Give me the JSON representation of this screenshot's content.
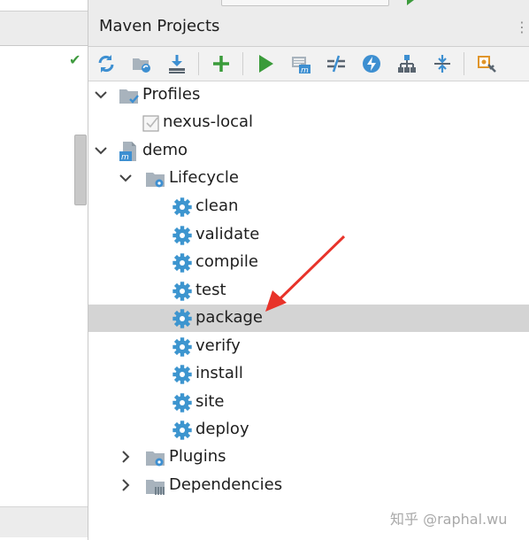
{
  "panel": {
    "title": "Maven Projects",
    "header_grip": "⋮"
  },
  "toolbar": {
    "buttons": [
      {
        "name": "reimport-icon"
      },
      {
        "name": "generate-sources-icon"
      },
      {
        "name": "download-icon"
      },
      {
        "name": "add-icon"
      },
      {
        "name": "run-icon"
      },
      {
        "name": "execute-goal-icon"
      },
      {
        "name": "toggle-offline-icon"
      },
      {
        "name": "skip-tests-icon"
      },
      {
        "name": "show-dependencies-icon"
      },
      {
        "name": "collapse-all-icon"
      },
      {
        "name": "settings-icon"
      }
    ]
  },
  "tree": {
    "profiles": {
      "label": "Profiles",
      "expanded": true,
      "children": [
        {
          "label": "nexus-local",
          "checked": false
        }
      ]
    },
    "project": {
      "label": "demo",
      "expanded": true
    },
    "lifecycle": {
      "label": "Lifecycle",
      "expanded": true,
      "goals": [
        "clean",
        "validate",
        "compile",
        "test",
        "package",
        "verify",
        "install",
        "site",
        "deploy"
      ],
      "selected": "package"
    },
    "plugins": {
      "label": "Plugins",
      "expanded": false
    },
    "dependencies": {
      "label": "Dependencies",
      "expanded": false
    }
  },
  "watermark": "知乎 @raphal.wu",
  "colors": {
    "gear": "#3d95cf",
    "selection": "#d4d4d4",
    "annotation": "#e8332a",
    "run": "#3a9b3a",
    "add": "#3a9b3a"
  }
}
